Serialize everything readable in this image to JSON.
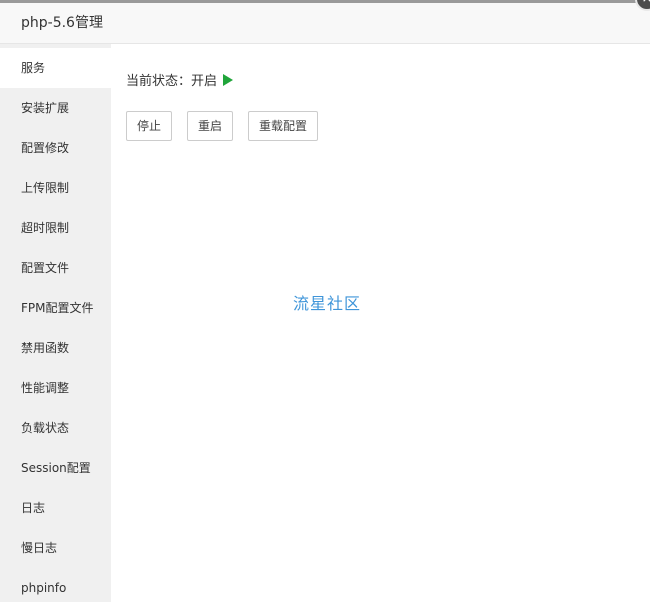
{
  "window": {
    "title": "php-5.6管理",
    "close_symbol": "×"
  },
  "sidebar": {
    "items": [
      {
        "label": "服务",
        "active": true
      },
      {
        "label": "安装扩展"
      },
      {
        "label": "配置修改"
      },
      {
        "label": "上传限制"
      },
      {
        "label": "超时限制"
      },
      {
        "label": "配置文件"
      },
      {
        "label": "FPM配置文件"
      },
      {
        "label": "禁用函数"
      },
      {
        "label": "性能调整"
      },
      {
        "label": "负载状态"
      },
      {
        "label": "Session配置"
      },
      {
        "label": "日志"
      },
      {
        "label": "慢日志"
      },
      {
        "label": "phpinfo"
      }
    ]
  },
  "main": {
    "status_label": "当前状态：",
    "status_value": "开启",
    "status_icon": "play-icon",
    "status_color": "#20a53a",
    "buttons": {
      "stop": "停止",
      "restart": "重启",
      "reload": "重载配置"
    },
    "watermark": "流星社区",
    "watermark_color": "#3f95d9"
  }
}
